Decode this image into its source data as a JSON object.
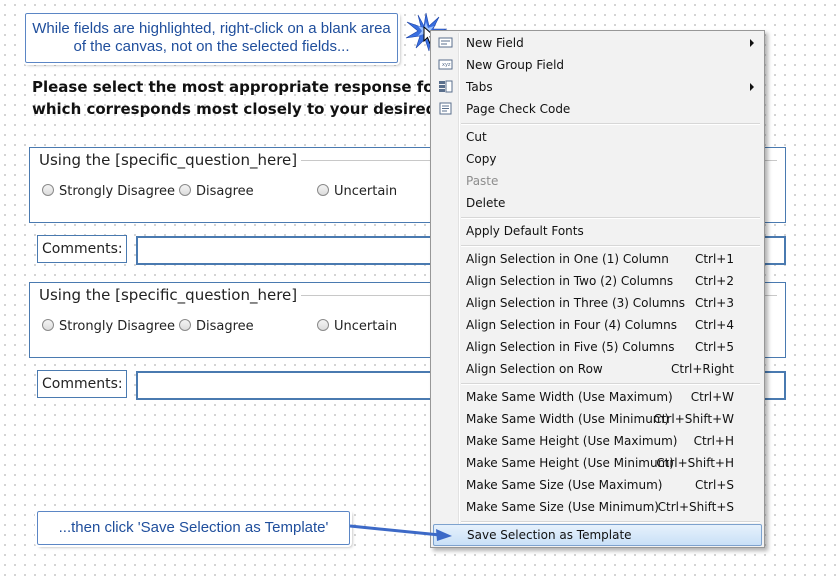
{
  "callouts": {
    "top": "While fields are highlighted, right-click on a blank area of the canvas, not on the selected fields...",
    "bottom": "...then click 'Save Selection as Template'"
  },
  "instructions": {
    "line1": "Please select the most appropriate response for each",
    "line2": "which corresponds most closely to your desired resp"
  },
  "questions": [
    {
      "title": "Using the [specific_question_here]",
      "options": [
        "Strongly Disagree",
        "Disagree",
        "Uncertain"
      ],
      "comments_label": "Comments:"
    },
    {
      "title": "Using the [specific_question_here]",
      "options": [
        "Strongly Disagree",
        "Disagree",
        "Uncertain"
      ],
      "comments_label": "Comments:"
    }
  ],
  "menu": {
    "items": [
      {
        "label": "New Field",
        "submenu": true,
        "icon": "field-icon"
      },
      {
        "label": "New Group Field",
        "icon": "group-field-icon"
      },
      {
        "label": "Tabs",
        "submenu": true,
        "icon": "tabs-icon"
      },
      {
        "label": "Page Check Code",
        "icon": "check-code-icon"
      },
      {
        "label": "Cut"
      },
      {
        "label": "Copy"
      },
      {
        "label": "Paste",
        "disabled": true
      },
      {
        "label": "Delete"
      },
      {
        "label": "Apply Default Fonts"
      },
      {
        "label": "Align Selection in One (1) Column",
        "shortcut": "Ctrl+1"
      },
      {
        "label": "Align Selection in Two (2) Columns",
        "shortcut": "Ctrl+2"
      },
      {
        "label": "Align Selection in Three (3) Columns",
        "shortcut": "Ctrl+3"
      },
      {
        "label": "Align Selection in Four (4) Columns",
        "shortcut": "Ctrl+4"
      },
      {
        "label": "Align Selection in Five (5) Columns",
        "shortcut": "Ctrl+5"
      },
      {
        "label": "Align Selection on Row",
        "shortcut": "Ctrl+Right"
      },
      {
        "label": "Make Same Width (Use Maximum)",
        "shortcut": "Ctrl+W"
      },
      {
        "label": "Make Same Width (Use Minimum)",
        "shortcut": "Ctrl+Shift+W"
      },
      {
        "label": "Make Same Height (Use Maximum)",
        "shortcut": "Ctrl+H"
      },
      {
        "label": "Make Same Height (Use Minimum)",
        "shortcut": "Ctrl+Shift+H"
      },
      {
        "label": "Make Same Size (Use Maximum)",
        "shortcut": "Ctrl+S"
      },
      {
        "label": "Make Same Size (Use Minimum)",
        "shortcut": "Ctrl+Shift+S"
      },
      {
        "label": "Save Selection as Template",
        "highlighted": true
      }
    ]
  },
  "colors": {
    "callout_text": "#1f4e9c",
    "field_border": "#4a7ab0",
    "highlight": "#c9e0f7"
  }
}
